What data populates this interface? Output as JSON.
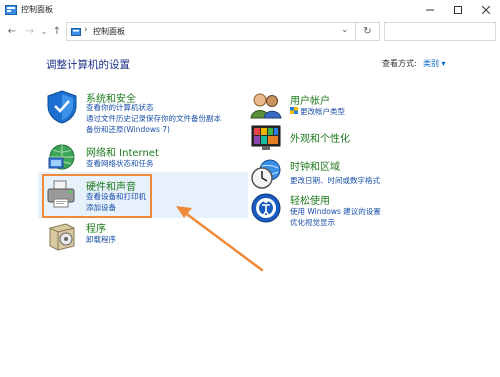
{
  "window": {
    "title": "控制面板"
  },
  "address": {
    "crumb": "控制面板",
    "separator": "›"
  },
  "main": {
    "heading": "调整计算机的设置",
    "view_by_label": "查看方式:",
    "view_by_value": "类别 ▾"
  },
  "left": [
    {
      "title": "系统和安全",
      "links": [
        "查看你的计算机状态",
        "通过文件历史记录保存你的文件备份副本",
        "备份和还原(Windows 7)"
      ]
    },
    {
      "title": "网络和 Internet",
      "links": [
        "查看网络状态和任务"
      ]
    },
    {
      "title": "硬件和声音",
      "links": [
        "查看设备和打印机",
        "添加设备"
      ]
    },
    {
      "title": "程序",
      "links": [
        "卸载程序"
      ]
    }
  ],
  "right": [
    {
      "title": "用户帐户",
      "links": [
        "更改帐户类型"
      ]
    },
    {
      "title": "外观和个性化",
      "links": []
    },
    {
      "title": "时钟和区域",
      "links": [
        "更改日期、时间或数字格式"
      ]
    },
    {
      "title": "轻松使用",
      "links": [
        "使用 Windows 建议的设置",
        "优化视觉显示"
      ]
    }
  ],
  "colors": {
    "heading": "#1e3287",
    "category_title": "#1e7a1e",
    "link": "#1a4fa8",
    "highlight": "#f08a3a"
  },
  "icons": [
    "control-panel-icon",
    "back-arrow-icon",
    "forward-arrow-icon",
    "up-arrow-icon",
    "refresh-icon",
    "search-icon",
    "shield-icon",
    "network-icon",
    "printer-icon",
    "programs-icon",
    "users-icon",
    "appearance-icon",
    "clock-icon",
    "accessibility-icon"
  ]
}
